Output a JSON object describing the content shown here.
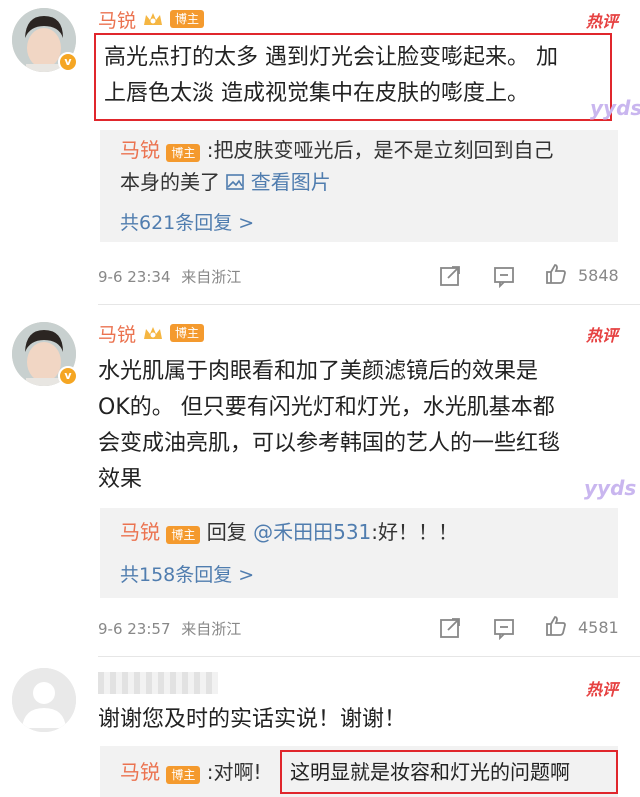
{
  "colors": {
    "author": "#eb7350",
    "link": "#507daf",
    "hot": "#e64141",
    "blogger_badge": "#f49a2e",
    "highlight_box": "#e0262c"
  },
  "hot_label": "热评",
  "blogger_label": "博主",
  "sticker_text": "yyds",
  "comments": [
    {
      "author": "马锐",
      "text_line1": "高光点打的太多 遇到灯光会让脸变嘭起来。 加",
      "text_line2": "上唇色太淡 造成视觉集中在皮肤的嘭度上。",
      "reply": {
        "author": "马锐",
        "text_line1": ":把皮肤变哑光后，是不是立刻回到自己",
        "text_line2": "本身的美了",
        "view_images": "查看图片",
        "count_label": "共621条回复 >"
      },
      "timestamp": "9-6 23:34",
      "source": "来自浙江",
      "likes": "5848"
    },
    {
      "author": "马锐",
      "text_line1": "水光肌属于肉眼看和加了美颜滤镜后的效果是",
      "text_line2": "OK的。 但只要有闪光灯和灯光，水光肌基本都",
      "text_line3": "会变成油亮肌，可以参考韩国的艺人的一些红毯",
      "text_line4": "效果",
      "reply": {
        "author": "马锐",
        "prefix": "回复",
        "mention": "@禾田田531",
        "text": ":好！！！",
        "count_label": "共158条回复 >"
      },
      "timestamp": "9-6 23:57",
      "source": "来自浙江",
      "likes": "4581"
    },
    {
      "text": "谢谢您及时的实话实说！谢谢！",
      "reply": {
        "author": "马锐",
        "prefix": ":对啊!",
        "highlight": "这明显就是妆容和灯光的问题啊"
      }
    }
  ]
}
